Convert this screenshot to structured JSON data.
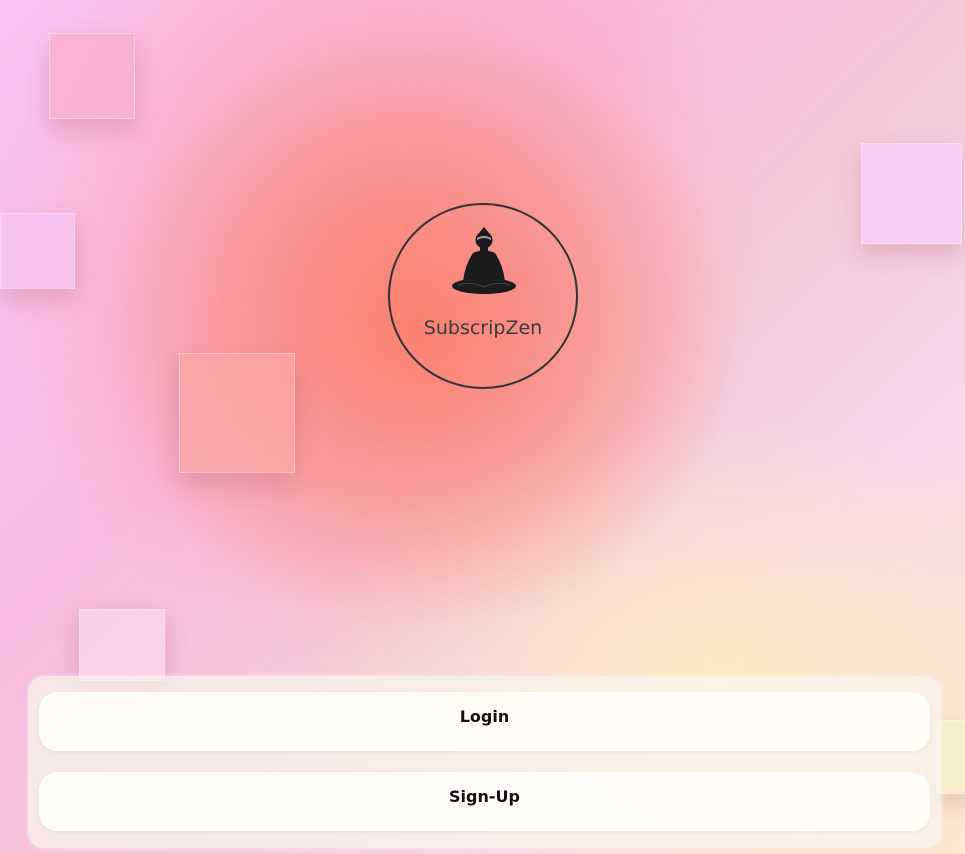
{
  "app": {
    "name": "SubscripZen",
    "logo_icon": "meditating-figure-icon"
  },
  "actions": {
    "login_label": "Login",
    "signup_label": "Sign-Up"
  },
  "colors": {
    "accent_coral": "#fa806e",
    "pink": "#f9c4f2",
    "cream": "#fcecbe",
    "text": "#111111"
  }
}
